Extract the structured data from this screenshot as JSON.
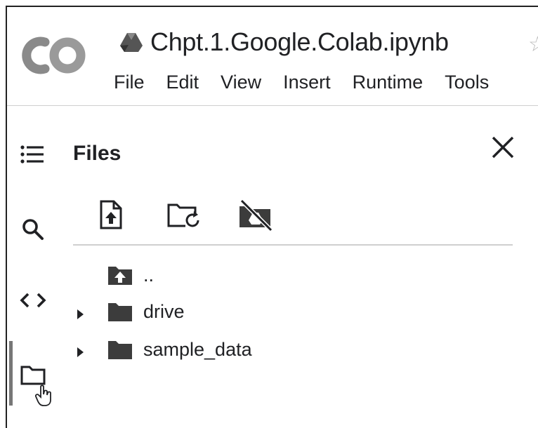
{
  "header": {
    "notebook_title": "Chpt.1.Google.Colab.ipynb",
    "logo_icon": "colab-logo",
    "drive_icon": "google-drive-icon",
    "star_icon": "star-icon"
  },
  "menu": {
    "items": [
      "File",
      "Edit",
      "View",
      "Insert",
      "Runtime",
      "Tools"
    ]
  },
  "sidebar_rail": {
    "icons": [
      "table-of-contents-icon",
      "search-icon",
      "code-snippets-icon",
      "files-folder-icon"
    ],
    "active": "files-folder-icon"
  },
  "files_panel": {
    "title": "Files",
    "tools": [
      "upload-file-icon",
      "refresh-folder-icon",
      "unmount-drive-icon"
    ],
    "close_icon": "close-icon",
    "tree": [
      {
        "name": "..",
        "icon": "parent-folder-icon",
        "expandable": false
      },
      {
        "name": "drive",
        "icon": "folder-icon",
        "expandable": true
      },
      {
        "name": "sample_data",
        "icon": "folder-icon",
        "expandable": true
      }
    ]
  },
  "colors": {
    "text": "#202124",
    "logo_gray": "#8a8a8a",
    "folder": "#3c3c3c",
    "divider": "#cfcfcf"
  }
}
